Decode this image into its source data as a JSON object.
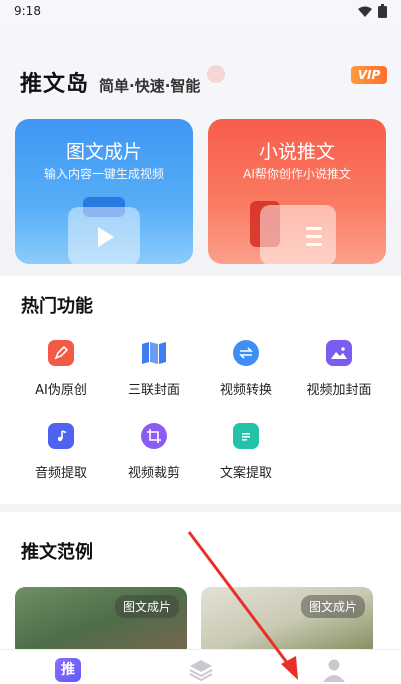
{
  "status_bar": {
    "time": "9:18"
  },
  "header": {
    "title": "推文岛",
    "slogan": "简单·快速·智能",
    "vip_label": "VIP"
  },
  "cards": [
    {
      "title": "图文成片",
      "subtitle": "输入内容一键生成视频",
      "color": "#4aa1f5"
    },
    {
      "title": "小说推文",
      "subtitle": "AI帮你创作小说推文",
      "color": "#f96a55"
    }
  ],
  "hot_features": {
    "title": "热门功能",
    "items": [
      {
        "label": "AI伪原创",
        "icon": "pen-icon",
        "color": "#f25a45"
      },
      {
        "label": "三联封面",
        "icon": "map-icon",
        "color": "#3f7df2"
      },
      {
        "label": "视频转换",
        "icon": "swap-icon",
        "color": "#3f8ef5"
      },
      {
        "label": "视频加封面",
        "icon": "image-icon",
        "color": "#7a5cf0"
      },
      {
        "label": "音频提取",
        "icon": "music-folder-icon",
        "color": "#4f63f0"
      },
      {
        "label": "视频裁剪",
        "icon": "crop-icon",
        "color": "#8a5cf2"
      },
      {
        "label": "文案提取",
        "icon": "document-icon",
        "color": "#22c2a8"
      }
    ]
  },
  "examples": {
    "title": "推文范例",
    "items": [
      {
        "tag": "图文成片"
      },
      {
        "tag": "图文成片"
      }
    ]
  },
  "tabbar": {
    "home_label": "推",
    "home_icon": "home-tab-icon",
    "layers_icon": "layers-icon",
    "profile_icon": "profile-icon"
  }
}
